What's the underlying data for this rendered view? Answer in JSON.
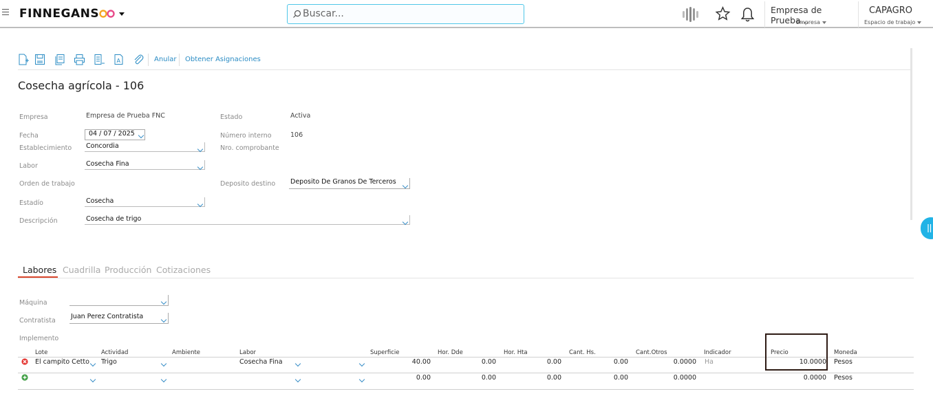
{
  "header": {
    "brand": "FINNEGANS",
    "search_placeholder": "Buscar...",
    "company_name": "Empresa de Prueba...",
    "company_label": "Empresa",
    "workspace_name": "CAPAGRO",
    "workspace_label": "Espacio de trabajo"
  },
  "toolbar": {
    "icons": [
      "new-document-icon",
      "save-icon",
      "copy-icon",
      "print-icon",
      "list-icon",
      "text-icon",
      "attach-icon"
    ],
    "annul_label": "Anular",
    "assign_label": "Obtener Asignaciones"
  },
  "page_title": "Cosecha agrícola - 106",
  "form": {
    "empresa_label": "Empresa",
    "empresa_value": "Empresa de Prueba FNC",
    "estado_label": "Estado",
    "estado_value": "Activa",
    "fecha_label": "Fecha",
    "fecha_value": "04 / 07 /  2025",
    "numero_label": "Número interno",
    "numero_value": "106",
    "establecimiento_label": "Establecimiento",
    "establecimiento_value": "Concordia",
    "comprobante_label": "Nro. comprobante",
    "labor_label": "Labor",
    "labor_value": "Cosecha Fina",
    "orden_label": "Orden de trabajo",
    "deposito_label": "Deposito destino",
    "deposito_value": "Deposito De Granos De Terceros",
    "estadio_label": "Estadío",
    "estadio_value": "Cosecha",
    "descripcion_label": "Descripción",
    "descripcion_value": "Cosecha de trigo"
  },
  "tabs": [
    {
      "label": "Labores",
      "active": true
    },
    {
      "label": "Cuadrilla",
      "active": false
    },
    {
      "label": "Producción",
      "active": false
    },
    {
      "label": "Cotizaciones",
      "active": false
    }
  ],
  "labores": {
    "maquina_label": "Máquina",
    "maquina_value": "",
    "contratista_label": "Contratista",
    "contratista_value": "Juan Perez Contratista",
    "implemento_label": "Implemento"
  },
  "grid": {
    "columns": [
      "Lote",
      "Actividad",
      "Ambiente",
      "Labor",
      "Superficie",
      "Hor. Dde",
      "Hor. Hta",
      "Cant. Hs.",
      "Cant.Otros",
      "Indicador",
      "Precio",
      "Moneda"
    ],
    "rows": [
      {
        "lote": "El campito Cetto",
        "actividad": "Trigo",
        "ambiente": "",
        "labor": "Cosecha Fina",
        "superficie": "40.00",
        "hor_dde": "0.00",
        "hor_hta": "0.00",
        "cant_hs": "0.00",
        "cant_otros": "0.0000",
        "indicador": "Ha",
        "precio": "10.0000",
        "moneda": "Pesos"
      },
      {
        "lote": "",
        "actividad": "",
        "ambiente": "",
        "labor": "",
        "superficie": "0.00",
        "hor_dde": "0.00",
        "hor_hta": "0.00",
        "cant_hs": "0.00",
        "cant_otros": "0.0000",
        "indicador": "",
        "precio": "0.0000",
        "moneda": "Pesos"
      }
    ]
  },
  "colors": {
    "accent": "#2b8cc4",
    "tab_active": "#d9452b",
    "search_border": "#4ec6e8",
    "delete": "#e53935",
    "add": "#43a047"
  }
}
